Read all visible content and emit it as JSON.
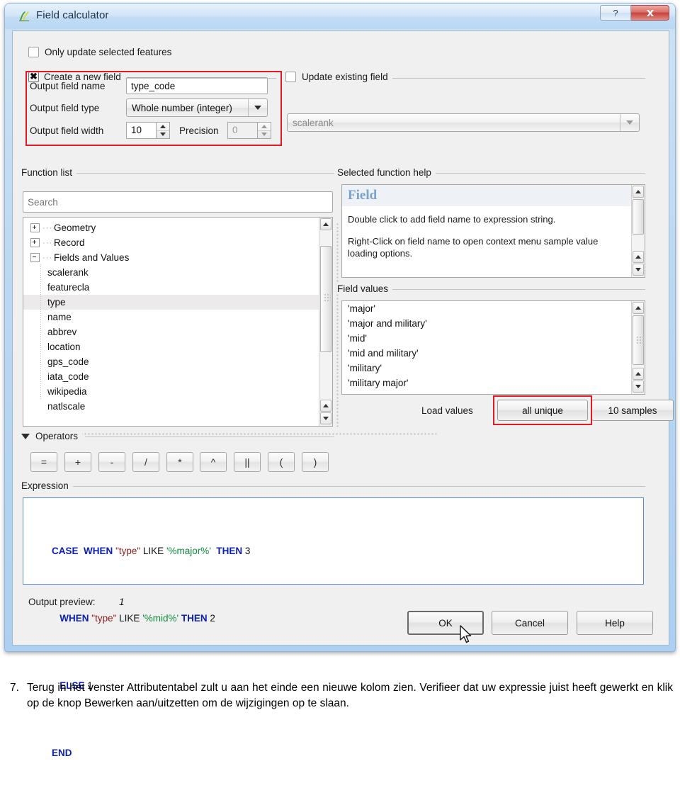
{
  "window": {
    "title": "Field calculator",
    "icon": "qgis-icon",
    "buttons": {
      "help": "?",
      "close": "✕"
    }
  },
  "options": {
    "only_update_selected": "Only update selected features",
    "create_new_field": "Create a new field",
    "update_existing_field": "Update existing field"
  },
  "new_field": {
    "name_label": "Output field name",
    "name_value": "type_code",
    "type_label": "Output field type",
    "type_value": "Whole number (integer)",
    "width_label": "Output field width",
    "width_value": "10",
    "precision_label": "Precision",
    "precision_value": "0"
  },
  "existing_field": {
    "value": "scalerank"
  },
  "function_list": {
    "title": "Function list",
    "search_placeholder": "Search",
    "search_value": "",
    "groups": [
      {
        "label": "Geometry",
        "expanded": false
      },
      {
        "label": "Record",
        "expanded": false
      },
      {
        "label": "Fields and Values",
        "expanded": true
      }
    ],
    "fields": [
      {
        "label": "scalerank",
        "selected": false
      },
      {
        "label": "featurecla",
        "selected": false
      },
      {
        "label": "type",
        "selected": true
      },
      {
        "label": "name",
        "selected": false
      },
      {
        "label": "abbrev",
        "selected": false
      },
      {
        "label": "location",
        "selected": false
      },
      {
        "label": "gps_code",
        "selected": false
      },
      {
        "label": "iata_code",
        "selected": false
      },
      {
        "label": "wikipedia",
        "selected": false
      },
      {
        "label": "natlscale",
        "selected": false
      }
    ]
  },
  "help": {
    "title": "Selected function help",
    "heading": "Field",
    "paragraph1": "Double click to add field name to expression string.",
    "paragraph2": "Right-Click on field name to open context menu sample value loading options."
  },
  "field_values": {
    "title": "Field values",
    "values": [
      "'major'",
      "'major and military'",
      "'mid'",
      "'mid and military'",
      "'military'",
      "'military major'"
    ],
    "load_label": "Load values",
    "all_unique_button": "all unique",
    "samples_button": "10 samples"
  },
  "operators": {
    "title": "Operators",
    "buttons": [
      "=",
      "+",
      "-",
      "/",
      "*",
      "^",
      "||",
      "(",
      ")"
    ]
  },
  "expression": {
    "title": "Expression",
    "lines": [
      [
        {
          "t": "CASE",
          "c": "kw"
        },
        {
          "t": "  ",
          "c": "pl"
        },
        {
          "t": "WHEN",
          "c": "kw"
        },
        {
          "t": " ",
          "c": "pl"
        },
        {
          "t": "\"type\"",
          "c": "fld"
        },
        {
          "t": " LIKE ",
          "c": "pl"
        },
        {
          "t": "'%major%'",
          "c": "str"
        },
        {
          "t": "  ",
          "c": "pl"
        },
        {
          "t": "THEN",
          "c": "kw"
        },
        {
          "t": " 3",
          "c": "pl"
        }
      ],
      [
        {
          "t": "   ",
          "c": "pl"
        },
        {
          "t": "WHEN",
          "c": "kw"
        },
        {
          "t": " ",
          "c": "pl"
        },
        {
          "t": "\"type\"",
          "c": "fld"
        },
        {
          "t": " LIKE ",
          "c": "pl"
        },
        {
          "t": "'%mid%'",
          "c": "str"
        },
        {
          "t": " ",
          "c": "pl"
        },
        {
          "t": "THEN",
          "c": "kw"
        },
        {
          "t": " 2",
          "c": "pl"
        }
      ],
      [
        {
          "t": "   ",
          "c": "pl"
        },
        {
          "t": "ELSE",
          "c": "kw"
        },
        {
          "t": " 1",
          "c": "pl"
        }
      ],
      [
        {
          "t": "END",
          "c": "kw"
        }
      ]
    ],
    "plain_text": "CASE  WHEN \"type\" LIKE '%major%'  THEN 3\n   WHEN \"type\" LIKE '%mid%' THEN 2\n   ELSE 1\nEND"
  },
  "output_preview": {
    "label": "Output preview:",
    "value": "1"
  },
  "dialog_buttons": {
    "ok": "OK",
    "cancel": "Cancel",
    "help": "Help"
  },
  "caption": {
    "number": "7.",
    "text": "Terug in het venster Attributentabel zult u aan het einde een nieuwe kolom zien. Verifieer dat uw expressie juist heeft gewerkt en klik op de knop Bewerken aan/uitzetten om de wijzigingen op te slaan."
  },
  "colors": {
    "highlight": "#e01b24",
    "keyword": "#0a1fb4",
    "field": "#8a1b1b",
    "string": "#0e8a3c",
    "title_bar": "#cfe2f5"
  }
}
